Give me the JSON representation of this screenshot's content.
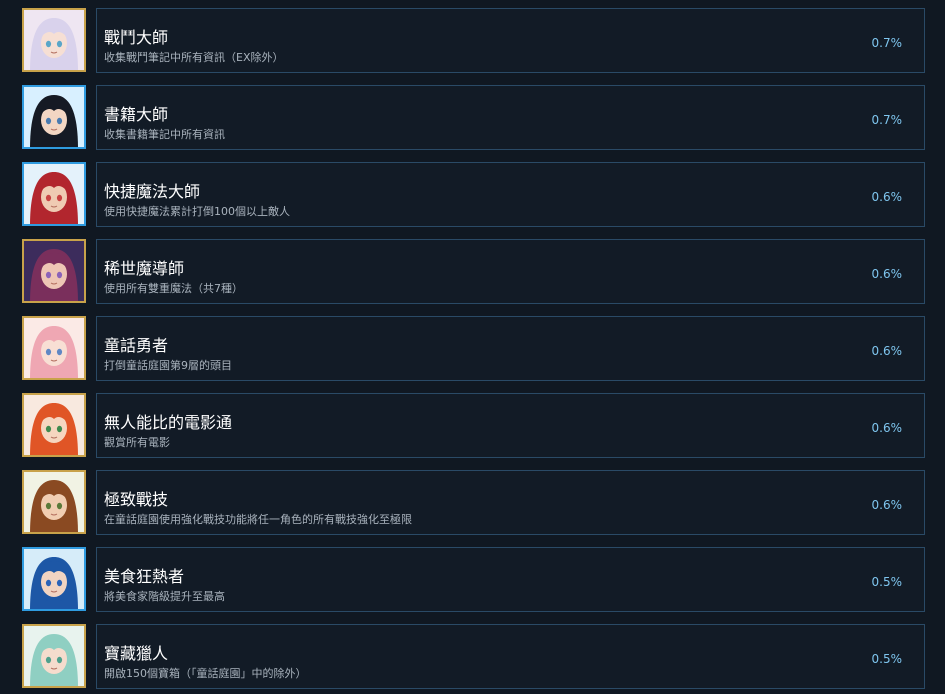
{
  "achievements": [
    {
      "title": "戰鬥大師",
      "desc": "收集戰鬥筆記中所有資訊（EX除外）",
      "pct": "0.7%",
      "portrait": "white-haired-girl-portrait-icon",
      "frame": "gold",
      "bg": "#efe6f2",
      "hair": "#d9d2ec",
      "skin": "#f6dfd4",
      "eye": "#5aa6c8"
    },
    {
      "title": "書籍大師",
      "desc": "收集書籍筆記中所有資訊",
      "pct": "0.7%",
      "portrait": "dark-haired-girl-portrait-icon",
      "frame": "blue",
      "bg": "#d8f0ff",
      "hair": "#151a24",
      "skin": "#f3d6c3",
      "eye": "#4a7bb0"
    },
    {
      "title": "快捷魔法大師",
      "desc": "使用快捷魔法累計打倒100個以上敵人",
      "pct": "0.6%",
      "portrait": "red-haired-man-portrait-icon",
      "frame": "blue",
      "bg": "#e4f2fb",
      "hair": "#b2262e",
      "skin": "#efcbb3",
      "eye": "#c94343"
    },
    {
      "title": "稀世魔導師",
      "desc": "使用所有雙重魔法（共7種）",
      "pct": "0.6%",
      "portrait": "purple-haired-man-portrait-icon",
      "frame": "gold",
      "bg": "#3c2c5c",
      "hair": "#7a2f5c",
      "skin": "#eec6b5",
      "eye": "#8b63b8"
    },
    {
      "title": "童話勇者",
      "desc": "打倒童話庭園第9層的頭目",
      "pct": "0.6%",
      "portrait": "pink-haired-girl-portrait-icon",
      "frame": "gold",
      "bg": "#fbeae6",
      "hair": "#efa7b3",
      "skin": "#f8dfd4",
      "eye": "#5f88c4"
    },
    {
      "title": "無人能比的電影通",
      "desc": "觀賞所有電影",
      "pct": "0.6%",
      "portrait": "orange-haired-girl-portrait-icon",
      "frame": "gold",
      "bg": "#f8e9df",
      "hair": "#e05526",
      "skin": "#f6d6c0",
      "eye": "#3f8a4e"
    },
    {
      "title": "極致戰技",
      "desc": "在童話庭園使用強化戰技功能將任一角色的所有戰技強化至極限",
      "pct": "0.6%",
      "portrait": "brown-haired-boy-portrait-icon",
      "frame": "gold",
      "bg": "#f1f3e4",
      "hair": "#8a4a22",
      "skin": "#f1ceb2",
      "eye": "#5b7a3a"
    },
    {
      "title": "美食狂熱者",
      "desc": "將美食家階級提升至最高",
      "pct": "0.5%",
      "portrait": "blue-haired-girl-portrait-icon",
      "frame": "blue",
      "bg": "#d6ecf9",
      "hair": "#1d57a6",
      "skin": "#f1d4c2",
      "eye": "#2a63b8"
    },
    {
      "title": "寶藏獵人",
      "desc": "開啟150個寶箱（「童話庭園」中的除外）",
      "pct": "0.5%",
      "portrait": "teal-haired-maid-portrait-icon",
      "frame": "gold",
      "bg": "#e8f3ee",
      "hair": "#8fcfc2",
      "skin": "#f5dccd",
      "eye": "#4fa08c"
    }
  ]
}
